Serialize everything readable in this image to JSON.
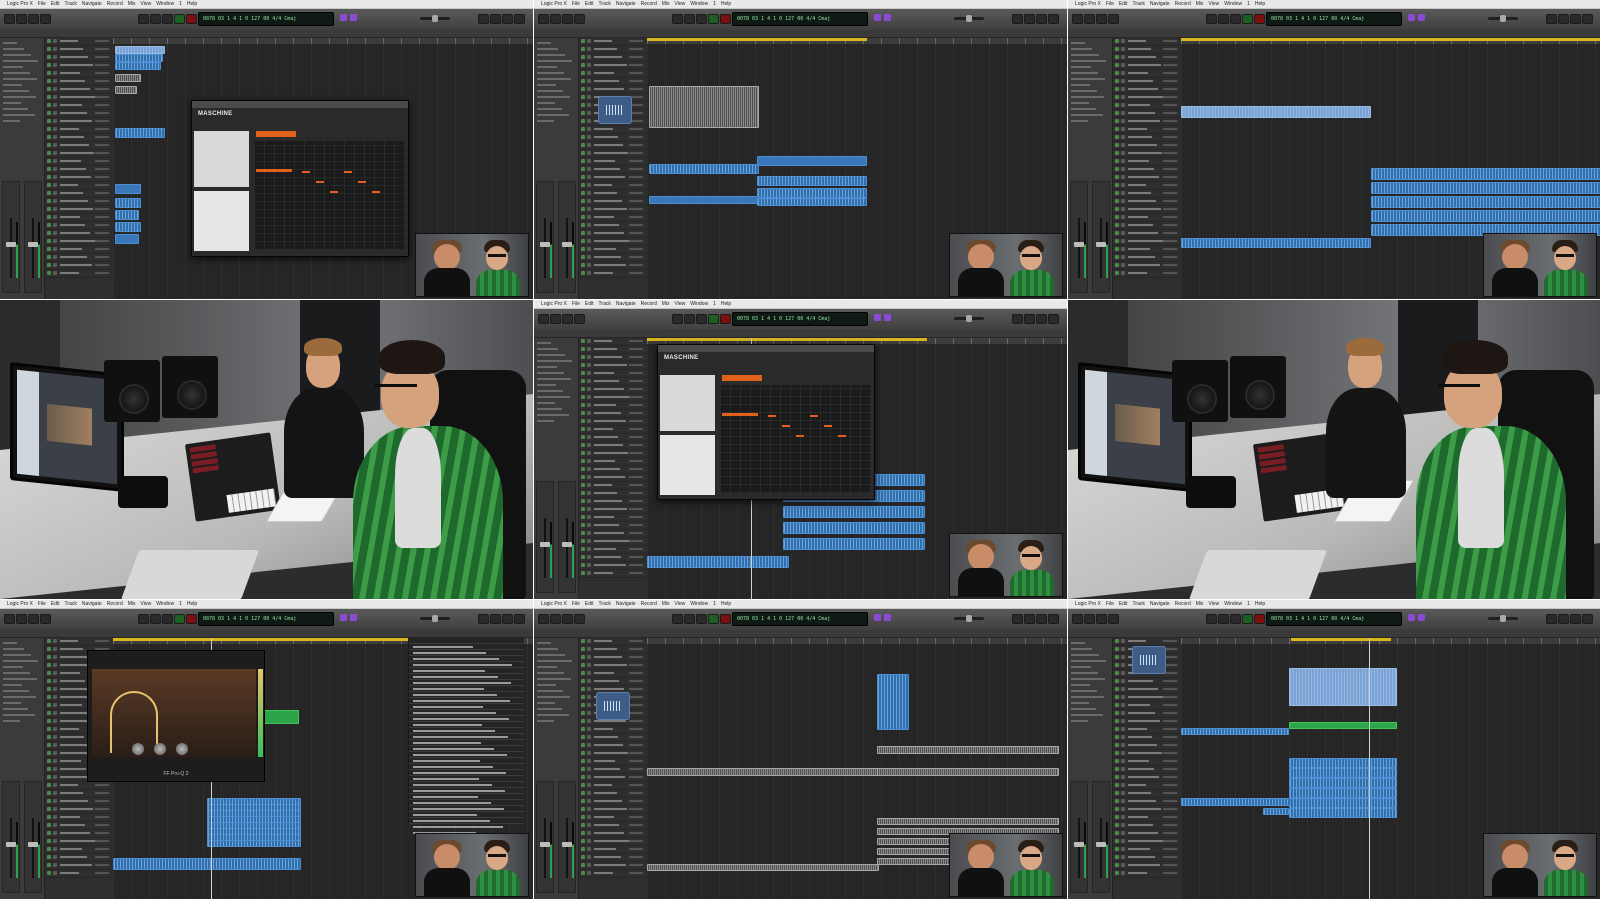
{
  "mosaic": {
    "menubar_items": [
      "Logic Pro X",
      "File",
      "Edit",
      "Track",
      "Navigate",
      "Record",
      "Mix",
      "View",
      "Window",
      "1",
      "Help"
    ],
    "apple_glyph": "",
    "lcd_text": "0078 03 1 4 1 0  127 00  4/4  Cmaj",
    "tiles": [
      {
        "type": "daw",
        "content": "maschine-plugin-open"
      },
      {
        "type": "daw",
        "content": "arrangement-regions"
      },
      {
        "type": "daw",
        "content": "arrangement-long-regions"
      },
      {
        "type": "studio-photo"
      },
      {
        "type": "daw",
        "content": "maschine-plugin-open"
      },
      {
        "type": "studio-photo"
      },
      {
        "type": "daw",
        "content": "pro-q-plugin-open"
      },
      {
        "type": "daw",
        "content": "audio-waveform-edit"
      },
      {
        "type": "daw",
        "content": "arrangement-green-region"
      }
    ]
  },
  "plugins": {
    "maschine_brand": "MASCHINE",
    "proq_title": "FF Pro-Q 2"
  },
  "colors": {
    "region_blue": "#2f6fb0",
    "region_green": "#2ea44a",
    "cycle_yellow": "#d9b81e",
    "record_red": "#7a1010",
    "maschine_orange": "#e0601c"
  },
  "icons": [
    "apple-icon",
    "waveform-icon",
    "play-icon",
    "record-icon",
    "fader-icon"
  ]
}
